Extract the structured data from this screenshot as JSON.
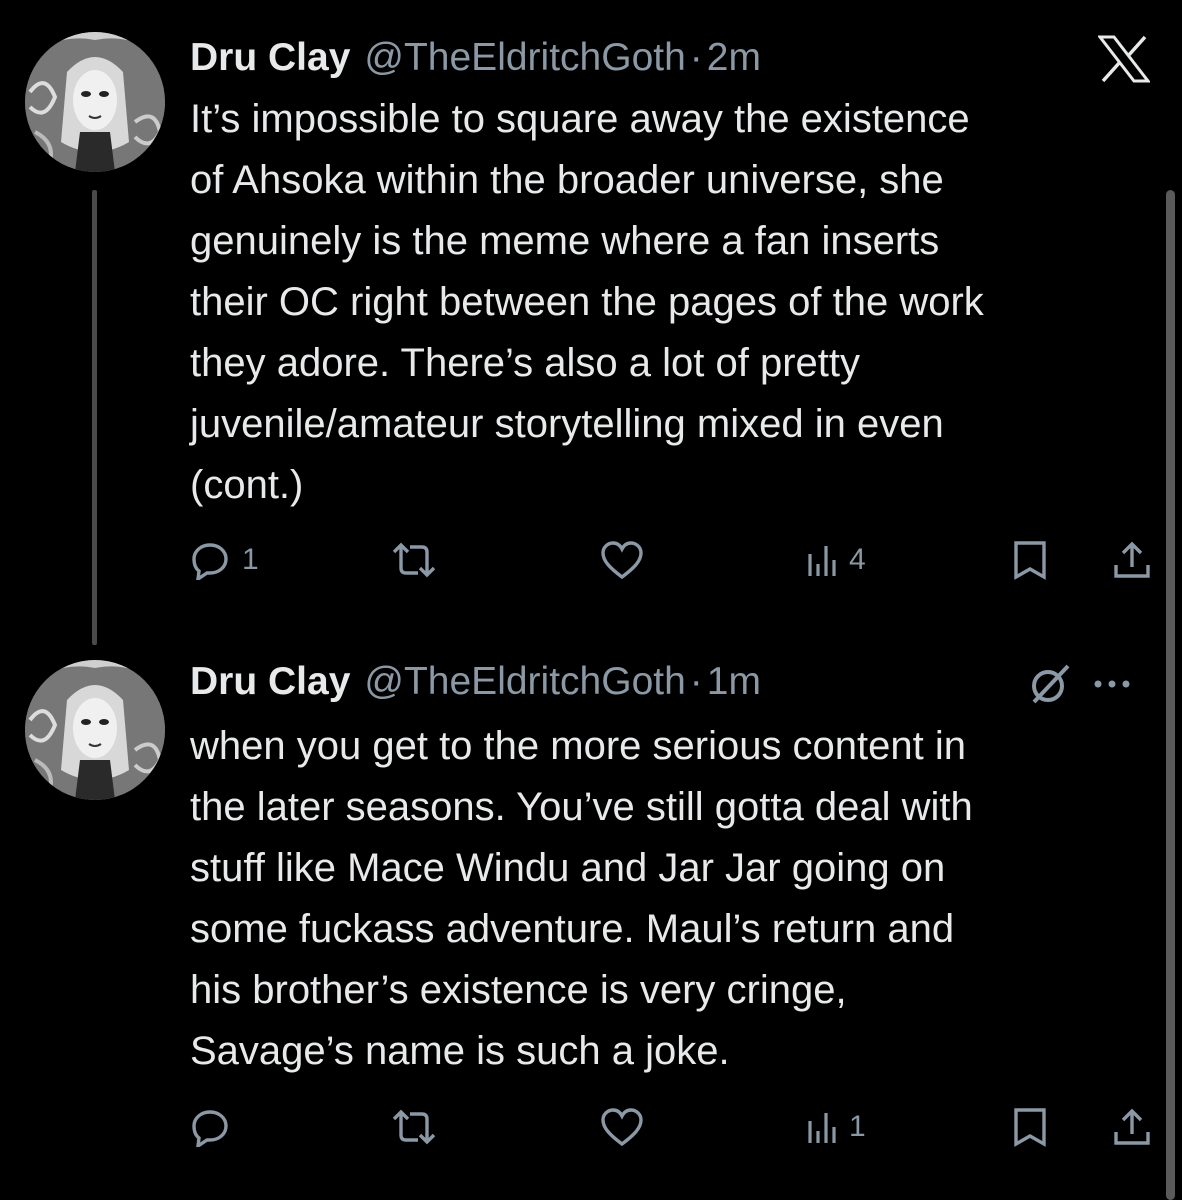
{
  "tweets": [
    {
      "author": {
        "name": "Dru Clay",
        "handle": "@TheEldritchGoth"
      },
      "separator": "·",
      "time": "2m",
      "lines": [
        "It’s impossible to square away the existence",
        "of Ahsoka within the broader universe, she",
        "genuinely is the meme where a fan inserts",
        "their OC right between the pages of the work",
        "they adore. There’s also a lot of pretty",
        "juvenile/amateur storytelling mixed in even",
        "(cont.)"
      ],
      "stats": {
        "replies": "1",
        "reposts": "",
        "likes": "",
        "views": "4"
      }
    },
    {
      "author": {
        "name": "Dru Clay",
        "handle": "@TheEldritchGoth"
      },
      "separator": "·",
      "time": "1m",
      "lines": [
        "when you get to the more serious content in",
        "the later seasons. You’ve still gotta deal with",
        "stuff like Mace Windu and Jar Jar going on",
        "some fuckass adventure. Maul’s return and",
        "his brother’s existence is very cringe,",
        "Savage’s name is such a joke."
      ],
      "stats": {
        "replies": "",
        "reposts": "",
        "likes": "",
        "views": "1"
      }
    }
  ],
  "icons": {
    "brand": "x-logo-icon",
    "reply": "reply-icon",
    "repost": "repost-icon",
    "like": "heart-icon",
    "views": "views-icon",
    "bookmark": "bookmark-icon",
    "share": "share-icon",
    "grok": "grok-icon",
    "more": "more-icon"
  },
  "colors": {
    "background": "#000000",
    "text": "#e7e9ea",
    "secondary": "#8b98a5"
  }
}
